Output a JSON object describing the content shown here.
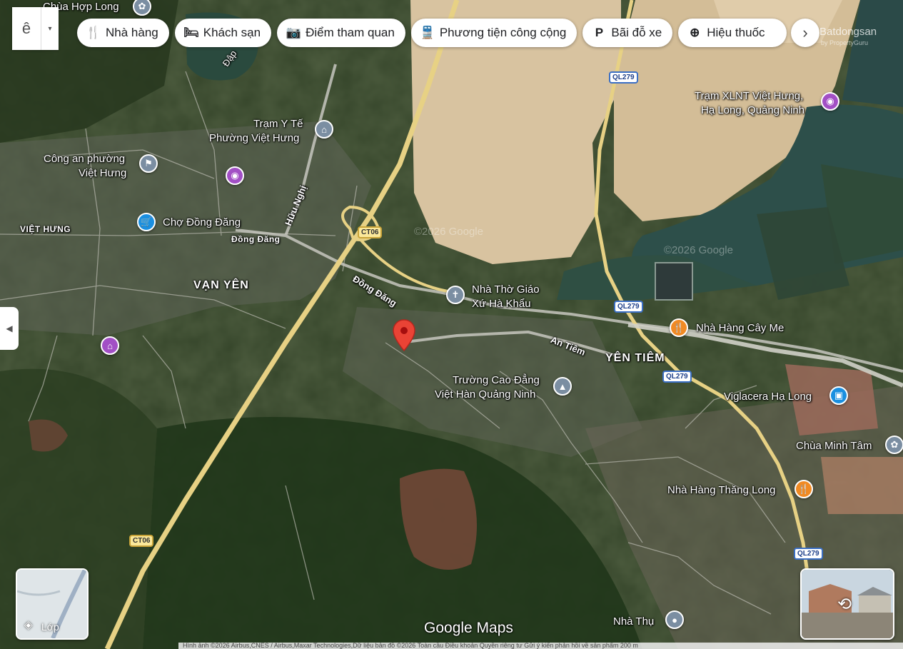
{
  "menu": {
    "glyph": "ê",
    "caret": "▾"
  },
  "chips": [
    {
      "label": "Nhà hàng",
      "icon": "restaurant-icon",
      "glyph": "🍴"
    },
    {
      "label": "Khách sạn",
      "icon": "hotel-icon",
      "glyph": "🛏"
    },
    {
      "label": "Điểm tham quan",
      "icon": "camera-icon",
      "glyph": "📷"
    },
    {
      "label": "Phương tiện công cộng",
      "icon": "transit-icon",
      "glyph": "🚆"
    },
    {
      "label": "Bãi đỗ xe",
      "icon": "parking-icon",
      "glyph": "P"
    },
    {
      "label": "Hiệu thuốc",
      "icon": "pharmacy-icon",
      "glyph": "⊕"
    }
  ],
  "chip_next": "›",
  "places": {
    "chua_hop_long": "Chùa Hợp Long",
    "dap": "Đập",
    "tram_y_te": [
      "Trạm Y Tế",
      "Phường Việt Hưng"
    ],
    "cong_an": [
      "Công an phường",
      "Việt Hưng"
    ],
    "viet_hung": "VIỆT HƯNG",
    "cho_dong_dang": "Chợ Đồng Đăng",
    "dong_dang_small": "Đồng Đăng",
    "huu_nghi": "Hữu Nghị",
    "van_yen": "VẠN YÊN",
    "dong_dang_road": "Đồng Đăng",
    "nha_tho": [
      "Nhà Thờ Giáo",
      "Xứ Hà Khẩu"
    ],
    "an_tiem": "An Tiêm",
    "yen_tiem": "YÊN TIÊM",
    "nha_hang_cay_me": "Nhà Hàng Cây Me",
    "truong_cao_dang": [
      "Trường Cao Đẳng",
      "Việt Hàn Quảng Ninh"
    ],
    "viglacera": "Viglacera Hạ Long",
    "chua_minh_tam": "Chùa Minh Tâm",
    "nha_hang_thang_long": "Nhà Hàng Thăng Long",
    "tram_xlnt": [
      "Trạm XLNT Việt Hưng,",
      "Hạ Long, Quảng Ninh"
    ],
    "nha_thu": "Nhà Thụ"
  },
  "shields": {
    "ql279": "QL279",
    "ct06": "CT06"
  },
  "watermarks": {
    "google_tile": "©2026 Google",
    "brand": "Batdongsan",
    "brand_sub": "by PropertyGuru"
  },
  "layers": {
    "label": "Lớp"
  },
  "google_logo": "Google Maps",
  "footer": "Hình ảnh ©2026 Airbus,CNES / Airbus,Maxar Technologies,Dữ liệu bản đồ ©2026   Toàn cầu   Điều khoản   Quyền riêng tư   Gửi ý kiến phản hồi về sản phẩm   200 m"
}
